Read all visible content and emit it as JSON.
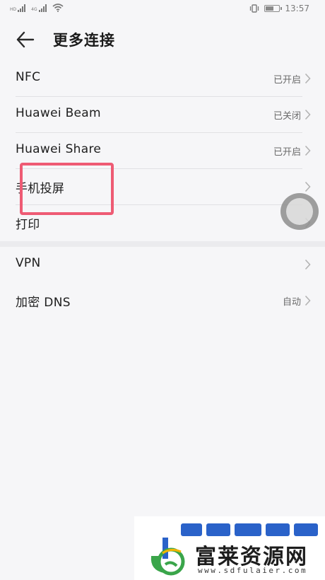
{
  "status_bar": {
    "sim1_label": "HD",
    "sim2_label": "4G",
    "time": "13:57"
  },
  "header": {
    "title": "更多连接",
    "back_icon": "arrow-left-icon"
  },
  "section1": {
    "items": [
      {
        "label": "NFC",
        "value": "已开启"
      },
      {
        "label": "Huawei Beam",
        "value": "已关闭"
      },
      {
        "label": "Huawei Share",
        "value": "已开启"
      },
      {
        "label": "手机投屏",
        "value": ""
      },
      {
        "label": "打印",
        "value": ""
      }
    ]
  },
  "section2": {
    "items": [
      {
        "label": "VPN",
        "value": ""
      },
      {
        "label": "加密 DNS",
        "value": "自动"
      }
    ]
  },
  "watermark": {
    "name": "富莱资源网",
    "url": "www.sdfulaier.com"
  },
  "colors": {
    "highlight": "#ee5b74",
    "background": "#f6f6f8",
    "watermark_blue": "#2a62c9",
    "watermark_green": "#3aa54a"
  }
}
